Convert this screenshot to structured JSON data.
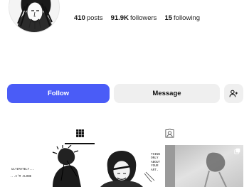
{
  "profile": {
    "stats": [
      {
        "value": "410",
        "label": "posts"
      },
      {
        "value": "91.9K",
        "label": "followers"
      },
      {
        "value": "15",
        "label": "following"
      }
    ]
  },
  "actions": {
    "follow_label": "Follow",
    "message_label": "Message",
    "suggest_icon": "person-add-icon"
  },
  "tabs": [
    {
      "icon": "grid-icon",
      "active": true
    },
    {
      "icon": "tagged-icon",
      "active": false
    }
  ],
  "posts": [
    {
      "texts": [
        "ULTIMATELY...",
        "...I'M ALONE"
      ]
    },
    {
      "texts": [
        "THINK\nONLY\nABOUT\nYOUR\nART."
      ]
    },
    {
      "texts": [],
      "multi": true,
      "multi_icon": "carousel-icon"
    }
  ],
  "colors": {
    "accent": "#4a5cf7",
    "button_secondary": "#efefef"
  }
}
